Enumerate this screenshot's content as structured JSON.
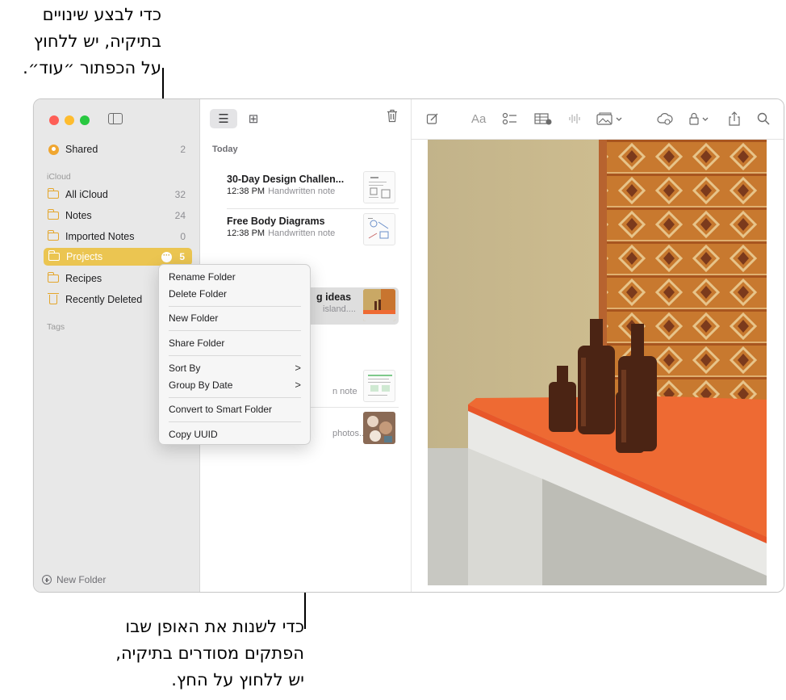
{
  "callouts": {
    "top": "כדי לבצע שינויים\nבתיקיה, יש ללחוץ\nעל הכפתור ״עוד״.",
    "bottom": "כדי לשנות את האופן שבו\nהפתקים מסודרים בתיקיה,\nיש ללחוץ על החץ."
  },
  "sidebar": {
    "shared": {
      "label": "Shared",
      "count": "2"
    },
    "icloud_header": "iCloud",
    "folders": [
      {
        "label": "All iCloud",
        "count": "32"
      },
      {
        "label": "Notes",
        "count": "24"
      },
      {
        "label": "Imported Notes",
        "count": "0"
      },
      {
        "label": "Projects",
        "count": "5"
      },
      {
        "label": "Recipes",
        "count": ""
      },
      {
        "label": "Recently Deleted",
        "count": ""
      }
    ],
    "more_glyph": "···",
    "tags_header": "Tags",
    "new_folder": "New Folder"
  },
  "note_list": {
    "view_list_icon": "☰",
    "view_grid_icon": "⊞",
    "trash_icon": "🗑",
    "section": "Today",
    "notes": [
      {
        "title": "30-Day Design Challen...",
        "time": "12:38 PM",
        "sub": "Handwritten note"
      },
      {
        "title": "Free Body Diagrams",
        "time": "12:38 PM",
        "sub": "Handwritten note"
      },
      {
        "title": "g ideas",
        "time": "",
        "sub": "island...."
      },
      {
        "title": "",
        "time": "",
        "sub": "n note"
      },
      {
        "title": "",
        "time": "",
        "sub": "photos..."
      }
    ]
  },
  "toolbar": {
    "compose": "✎",
    "format": "Aa",
    "checklist": "☰",
    "table": "▦",
    "audio": "⦀",
    "media": "▣ ⌄",
    "collab": "☁",
    "lock": "🔒︎ ⌄",
    "share": "⇪",
    "search": "⌕"
  },
  "context_menu": {
    "items": [
      "Rename Folder",
      "Delete Folder",
      "New Folder",
      "Share Folder",
      "Sort By",
      "Group By Date",
      "Convert to Smart Folder",
      "Copy UUID"
    ],
    "chevron": ">"
  },
  "colors": {
    "accent": "#ebc551",
    "folder_icon": "#e4a62c",
    "shelf": "#ee6a33"
  }
}
